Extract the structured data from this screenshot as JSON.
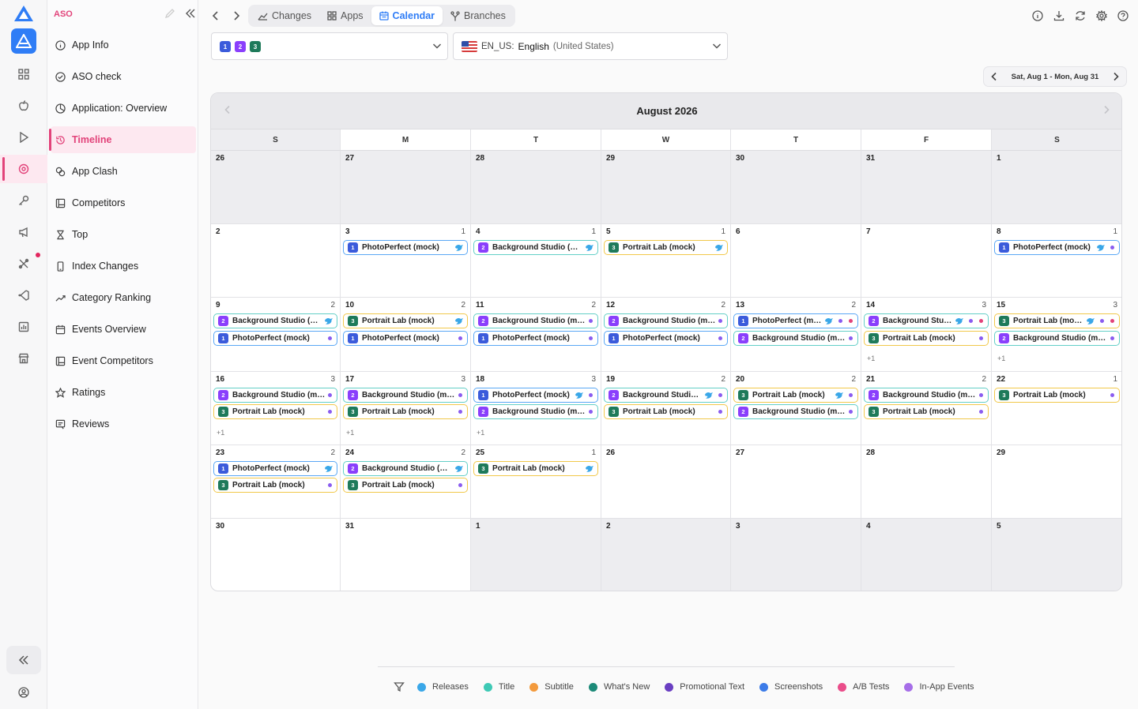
{
  "sidebar": {
    "section_title": "ASO",
    "items": [
      {
        "label": "App Info",
        "icon": "info-icon"
      },
      {
        "label": "ASO check",
        "icon": "check-circle-icon"
      },
      {
        "label": "Application: Overview",
        "icon": "pie-chart-icon"
      },
      {
        "label": "Timeline",
        "icon": "history-icon",
        "active": true
      },
      {
        "label": "App Clash",
        "icon": "clash-icon"
      },
      {
        "label": "Competitors",
        "icon": "panel-icon"
      },
      {
        "label": "Top",
        "icon": "hourglass-icon"
      },
      {
        "label": "Index Changes",
        "icon": "phone-icon"
      },
      {
        "label": "Category Ranking",
        "icon": "trend-up-icon"
      },
      {
        "label": "Events Overview",
        "icon": "calendar-icon"
      },
      {
        "label": "Event Competitors",
        "icon": "panel-icon"
      },
      {
        "label": "Ratings",
        "icon": "star-icon"
      },
      {
        "label": "Reviews",
        "icon": "reviews-icon"
      }
    ]
  },
  "topbar": {
    "tabs": [
      {
        "label": "Changes",
        "icon": "line-chart-icon"
      },
      {
        "label": "Apps",
        "icon": "apps-icon"
      },
      {
        "label": "Calendar",
        "icon": "calendar-icon",
        "active": true
      },
      {
        "label": "Branches",
        "icon": "branch-icon"
      }
    ]
  },
  "filters": {
    "versions": [
      "1",
      "2",
      "3"
    ],
    "locale_code": "EN_US:",
    "locale_name": "English",
    "locale_region": "(United States)"
  },
  "date_range": "Sat, Aug 1 - Mon, Aug 31",
  "calendar": {
    "month_title": "August 2026",
    "weekdays": [
      "S",
      "M",
      "T",
      "W",
      "T",
      "F",
      "S"
    ],
    "weeks": [
      [
        {
          "d": "26",
          "out": true,
          "events": []
        },
        {
          "d": "27",
          "out": true,
          "events": []
        },
        {
          "d": "28",
          "out": true,
          "events": []
        },
        {
          "d": "29",
          "out": true,
          "events": []
        },
        {
          "d": "30",
          "out": true,
          "events": []
        },
        {
          "d": "31",
          "out": true,
          "events": []
        },
        {
          "d": "1",
          "events": []
        }
      ],
      [
        {
          "d": "2",
          "events": []
        },
        {
          "d": "3",
          "count": "1",
          "events": [
            {
              "v": "1",
              "name": "PhotoPerfect (mock)",
              "border": "blue",
              "bird": true
            }
          ]
        },
        {
          "d": "4",
          "count": "1",
          "events": [
            {
              "v": "2",
              "name": "Background Studio (mock)",
              "border": "teal",
              "bird": true
            }
          ]
        },
        {
          "d": "5",
          "count": "1",
          "events": [
            {
              "v": "3",
              "name": "Portrait Lab (mock)",
              "border": "yellow",
              "bird": true
            }
          ]
        },
        {
          "d": "6",
          "events": []
        },
        {
          "d": "7",
          "events": []
        },
        {
          "d": "8",
          "count": "1",
          "events": [
            {
              "v": "1",
              "name": "PhotoPerfect (mock)",
              "border": "blue",
              "bird": true,
              "dots": [
                "#8a5cf0"
              ]
            }
          ]
        }
      ],
      [
        {
          "d": "9",
          "count": "2",
          "events": [
            {
              "v": "2",
              "name": "Background Studio (mock)",
              "border": "teal",
              "bird": true
            },
            {
              "v": "1",
              "name": "PhotoPerfect (mock)",
              "border": "blue",
              "dots": [
                "#8a5cf0"
              ]
            }
          ]
        },
        {
          "d": "10",
          "count": "2",
          "events": [
            {
              "v": "3",
              "name": "Portrait Lab (mock)",
              "border": "yellow",
              "bird": true
            },
            {
              "v": "1",
              "name": "PhotoPerfect (mock)",
              "border": "blue",
              "dots": [
                "#8a5cf0"
              ]
            }
          ]
        },
        {
          "d": "11",
          "count": "2",
          "events": [
            {
              "v": "2",
              "name": "Background Studio (mock)",
              "border": "teal",
              "dots": [
                "#8a5cf0"
              ]
            },
            {
              "v": "1",
              "name": "PhotoPerfect (mock)",
              "border": "blue",
              "dots": [
                "#8a5cf0"
              ]
            }
          ]
        },
        {
          "d": "12",
          "count": "2",
          "events": [
            {
              "v": "2",
              "name": "Background Studio (mock)",
              "border": "teal",
              "dots": [
                "#8a5cf0"
              ]
            },
            {
              "v": "1",
              "name": "PhotoPerfect (mock)",
              "border": "blue",
              "dots": [
                "#8a5cf0"
              ]
            }
          ]
        },
        {
          "d": "13",
          "count": "2",
          "events": [
            {
              "v": "1",
              "name": "PhotoPerfect (mock)",
              "border": "blue",
              "bird": true,
              "dots": [
                "#8a5cf0",
                "#e2437a"
              ]
            },
            {
              "v": "2",
              "name": "Background Studio (mock)",
              "border": "teal",
              "dots": [
                "#8a5cf0"
              ]
            }
          ]
        },
        {
          "d": "14",
          "count": "3",
          "events": [
            {
              "v": "2",
              "name": "Background Studio (mock)",
              "border": "teal",
              "bird": true,
              "dots": [
                "#8a5cf0",
                "#e2437a"
              ]
            },
            {
              "v": "3",
              "name": "Portrait Lab (mock)",
              "border": "yellow",
              "dots": [
                "#8a5cf0"
              ]
            }
          ],
          "more": "+1"
        },
        {
          "d": "15",
          "count": "3",
          "events": [
            {
              "v": "3",
              "name": "Portrait Lab (mock)",
              "border": "yellow",
              "bird": true,
              "dots": [
                "#8a5cf0",
                "#e2437a"
              ]
            },
            {
              "v": "2",
              "name": "Background Studio (mock)",
              "border": "teal",
              "dots": [
                "#8a5cf0"
              ]
            }
          ],
          "more": "+1"
        }
      ],
      [
        {
          "d": "16",
          "count": "3",
          "events": [
            {
              "v": "2",
              "name": "Background Studio (mock)",
              "border": "teal",
              "dots": [
                "#8a5cf0"
              ]
            },
            {
              "v": "3",
              "name": "Portrait Lab (mock)",
              "border": "yellow",
              "dots": [
                "#8a5cf0"
              ]
            }
          ],
          "more": "+1"
        },
        {
          "d": "17",
          "count": "3",
          "events": [
            {
              "v": "2",
              "name": "Background Studio (mock)",
              "border": "teal",
              "dots": [
                "#8a5cf0"
              ]
            },
            {
              "v": "3",
              "name": "Portrait Lab (mock)",
              "border": "yellow",
              "dots": [
                "#8a5cf0"
              ]
            }
          ],
          "more": "+1"
        },
        {
          "d": "18",
          "count": "3",
          "events": [
            {
              "v": "1",
              "name": "PhotoPerfect (mock)",
              "border": "blue",
              "bird": true,
              "dots": [
                "#8a5cf0"
              ]
            },
            {
              "v": "2",
              "name": "Background Studio (mock)",
              "border": "teal",
              "dots": [
                "#8a5cf0"
              ]
            }
          ],
          "more": "+1"
        },
        {
          "d": "19",
          "count": "2",
          "events": [
            {
              "v": "2",
              "name": "Background Studio (mock)",
              "border": "teal",
              "bird": true,
              "dots": [
                "#8a5cf0"
              ]
            },
            {
              "v": "3",
              "name": "Portrait Lab (mock)",
              "border": "yellow",
              "dots": [
                "#8a5cf0"
              ]
            }
          ]
        },
        {
          "d": "20",
          "count": "2",
          "events": [
            {
              "v": "3",
              "name": "Portrait Lab (mock)",
              "border": "yellow",
              "bird": true,
              "dots": [
                "#8a5cf0"
              ]
            },
            {
              "v": "2",
              "name": "Background Studio (mock)",
              "border": "teal",
              "dots": [
                "#8a5cf0"
              ]
            }
          ]
        },
        {
          "d": "21",
          "count": "2",
          "events": [
            {
              "v": "2",
              "name": "Background Studio (mock)",
              "border": "teal",
              "dots": [
                "#8a5cf0"
              ]
            },
            {
              "v": "3",
              "name": "Portrait Lab (mock)",
              "border": "yellow",
              "dots": [
                "#8a5cf0"
              ]
            }
          ]
        },
        {
          "d": "22",
          "count": "1",
          "events": [
            {
              "v": "3",
              "name": "Portrait Lab (mock)",
              "border": "yellow",
              "dots": [
                "#8a5cf0"
              ]
            }
          ]
        }
      ],
      [
        {
          "d": "23",
          "count": "2",
          "events": [
            {
              "v": "1",
              "name": "PhotoPerfect (mock)",
              "border": "blue",
              "bird": true
            },
            {
              "v": "3",
              "name": "Portrait Lab (mock)",
              "border": "yellow",
              "dots": [
                "#8a5cf0"
              ]
            }
          ]
        },
        {
          "d": "24",
          "count": "2",
          "events": [
            {
              "v": "2",
              "name": "Background Studio (mock)",
              "border": "teal",
              "bird": true
            },
            {
              "v": "3",
              "name": "Portrait Lab (mock)",
              "border": "yellow",
              "dots": [
                "#8a5cf0"
              ]
            }
          ]
        },
        {
          "d": "25",
          "count": "1",
          "events": [
            {
              "v": "3",
              "name": "Portrait Lab (mock)",
              "border": "yellow",
              "bird": true
            }
          ]
        },
        {
          "d": "26",
          "events": []
        },
        {
          "d": "27",
          "events": []
        },
        {
          "d": "28",
          "events": []
        },
        {
          "d": "29",
          "events": []
        }
      ],
      [
        {
          "d": "30",
          "events": []
        },
        {
          "d": "31",
          "events": []
        },
        {
          "d": "1",
          "out": true,
          "events": []
        },
        {
          "d": "2",
          "out": true,
          "events": []
        },
        {
          "d": "3",
          "out": true,
          "events": []
        },
        {
          "d": "4",
          "out": true,
          "events": []
        },
        {
          "d": "5",
          "out": true,
          "events": []
        }
      ]
    ]
  },
  "legend": [
    {
      "label": "Releases",
      "color": "#3aa7e8"
    },
    {
      "label": "Title",
      "color": "#3ec9b5"
    },
    {
      "label": "Subtitle",
      "color": "#f39a3c"
    },
    {
      "label": "What's New",
      "color": "#1c8a78"
    },
    {
      "label": "Promotional Text",
      "color": "#6a3fc2"
    },
    {
      "label": "Screenshots",
      "color": "#3b7be8"
    },
    {
      "label": "A/B Tests",
      "color": "#ea4d8a"
    },
    {
      "label": "In-App Events",
      "color": "#a66ee8"
    }
  ],
  "colors": {
    "accent": "#e2437a",
    "primary": "#2f7df6",
    "version_1": "#3b5bdb",
    "version_2": "#8a3ffc",
    "version_3": "#1e7a5a"
  }
}
